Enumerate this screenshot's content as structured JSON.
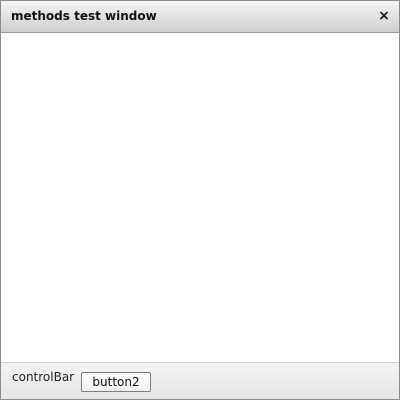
{
  "window": {
    "title": "methods test window",
    "close_glyph": "×",
    "close_icon": "close-icon"
  },
  "controlBar": {
    "label": "controlBar",
    "buttons": [
      {
        "label": "button2"
      }
    ]
  }
}
